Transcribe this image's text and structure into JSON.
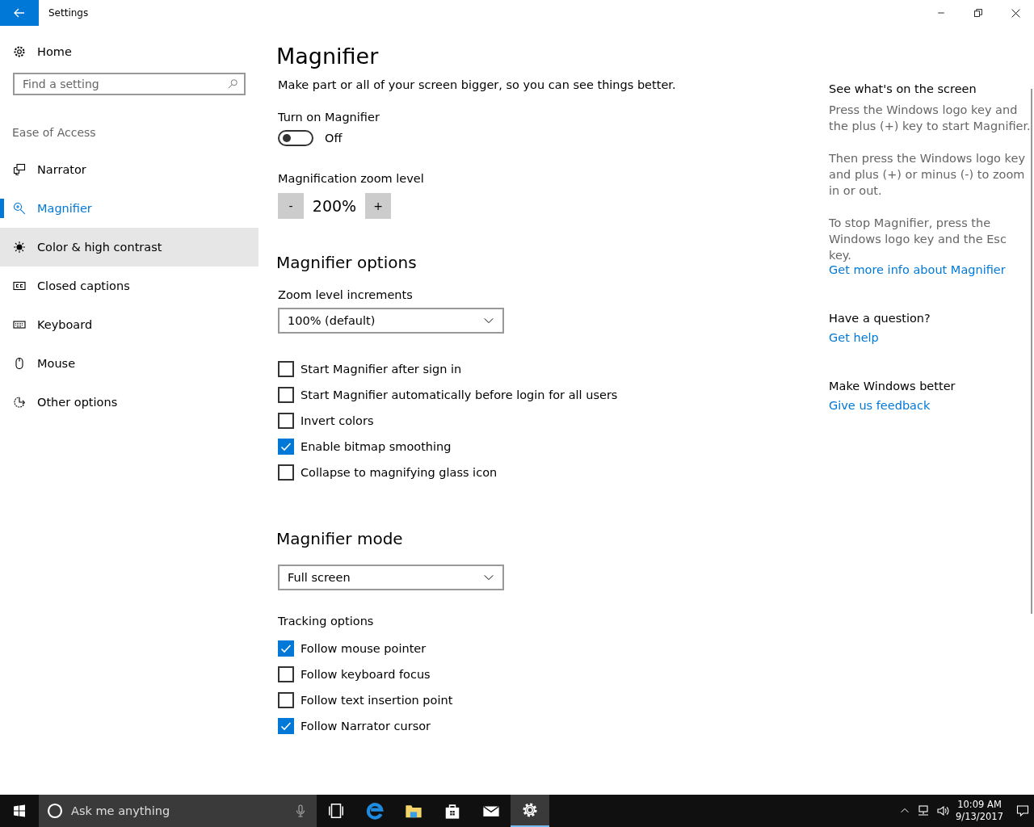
{
  "window": {
    "title": "Settings"
  },
  "sidebar": {
    "home": "Home",
    "search": {
      "placeholder": "Find a setting"
    },
    "section": "Ease of Access",
    "items": [
      {
        "label": "Narrator",
        "selected": false,
        "hovered": false
      },
      {
        "label": "Magnifier",
        "selected": true,
        "hovered": false
      },
      {
        "label": "Color & high contrast",
        "selected": false,
        "hovered": true
      },
      {
        "label": "Closed captions",
        "selected": false,
        "hovered": false
      },
      {
        "label": "Keyboard",
        "selected": false,
        "hovered": false
      },
      {
        "label": "Mouse",
        "selected": false,
        "hovered": false
      },
      {
        "label": "Other options",
        "selected": false,
        "hovered": false
      }
    ]
  },
  "main": {
    "title": "Magnifier",
    "description": "Make part or all of your screen bigger, so you can see things better.",
    "toggle": {
      "label": "Turn on Magnifier",
      "on": false,
      "state_text": "Off"
    },
    "zoom": {
      "label": "Magnification zoom level",
      "minus": "-",
      "value": "200%",
      "plus": "+"
    },
    "options": {
      "heading": "Magnifier options",
      "increments_label": "Zoom level increments",
      "increments_value": "100% (default)",
      "checkboxes": [
        {
          "label": "Start Magnifier after sign in",
          "checked": false
        },
        {
          "label": "Start Magnifier automatically before login for all users",
          "checked": false
        },
        {
          "label": "Invert colors",
          "checked": false
        },
        {
          "label": "Enable bitmap smoothing",
          "checked": true
        },
        {
          "label": "Collapse to magnifying glass icon",
          "checked": false
        }
      ]
    },
    "mode": {
      "heading": "Magnifier mode",
      "value": "Full screen",
      "tracking_label": "Tracking options",
      "checkboxes": [
        {
          "label": "Follow mouse pointer",
          "checked": true
        },
        {
          "label": "Follow keyboard focus",
          "checked": false
        },
        {
          "label": "Follow text insertion point",
          "checked": false
        },
        {
          "label": "Follow Narrator cursor",
          "checked": true
        }
      ]
    }
  },
  "aside": [
    {
      "heading": "See what's on the screen",
      "paragraphs": [
        "Press the Windows logo key and the plus (+) key to start Magnifier.",
        "Then press the Windows logo key and plus (+) or minus (-) to zoom in or out.",
        "To stop Magnifier, press the Windows logo key and the Esc key."
      ],
      "link": "Get more info about Magnifier"
    },
    {
      "heading": "Have a question?",
      "link": "Get help"
    },
    {
      "heading": "Make Windows better",
      "link": "Give us feedback"
    }
  ],
  "taskbar": {
    "search_placeholder": "Ask me anything",
    "apps": [
      {
        "selected": false
      },
      {
        "selected": false
      },
      {
        "selected": false
      },
      {
        "selected": false
      },
      {
        "selected": false
      },
      {
        "selected": true
      }
    ],
    "time": "10:09 AM",
    "date": "9/13/2017"
  }
}
